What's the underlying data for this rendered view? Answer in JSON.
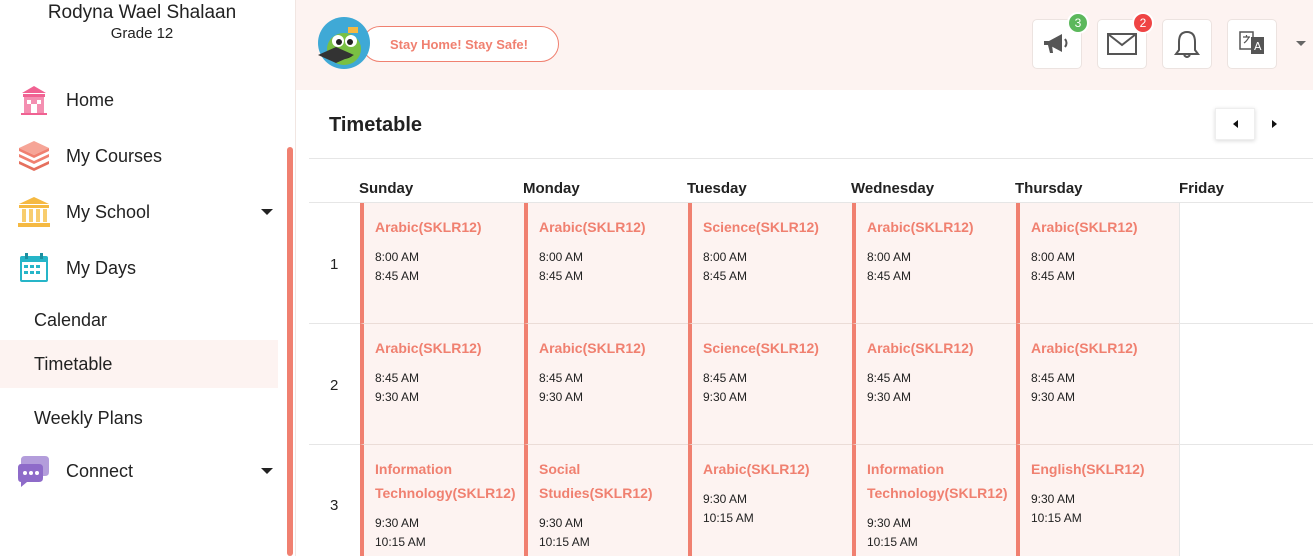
{
  "profile": {
    "name": "Rodyna Wael Shalaan",
    "grade": "Grade 12"
  },
  "sidebar": {
    "items": [
      {
        "label": "Home",
        "icon": "school-building-icon",
        "color": "#f06292"
      },
      {
        "label": "My Courses",
        "icon": "books-stack-icon",
        "color": "#f08070"
      },
      {
        "label": "My School",
        "icon": "institution-columns-icon",
        "color": "#f5b942"
      },
      {
        "label": "My Days",
        "icon": "calendar-icon",
        "color": "#26b5c8"
      }
    ],
    "sub_items": [
      {
        "label": "Calendar"
      },
      {
        "label": "Timetable",
        "active": true
      },
      {
        "label": "Weekly Plans"
      }
    ],
    "connect": {
      "label": "Connect",
      "icon": "chat-bubbles-icon",
      "color": "#8e6bc9"
    }
  },
  "topbar": {
    "banner": "Stay Home! Stay Safe!",
    "announcements_badge": "3",
    "messages_badge": "2"
  },
  "timetable": {
    "title": "Timetable",
    "days": [
      "Sunday",
      "Monday",
      "Tuesday",
      "Wednesday",
      "Thursday",
      "Friday"
    ],
    "periods": [
      {
        "number": "1",
        "cells": [
          {
            "subject": "Arabic(SKLR12)",
            "start": "8:00 AM",
            "end": "8:45 AM"
          },
          {
            "subject": "Arabic(SKLR12)",
            "start": "8:00 AM",
            "end": "8:45 AM"
          },
          {
            "subject": "Science(SKLR12)",
            "start": "8:00 AM",
            "end": "8:45 AM"
          },
          {
            "subject": "Arabic(SKLR12)",
            "start": "8:00 AM",
            "end": "8:45 AM"
          },
          {
            "subject": "Arabic(SKLR12)",
            "start": "8:00 AM",
            "end": "8:45 AM"
          }
        ]
      },
      {
        "number": "2",
        "cells": [
          {
            "subject": "Arabic(SKLR12)",
            "start": "8:45 AM",
            "end": "9:30 AM"
          },
          {
            "subject": "Arabic(SKLR12)",
            "start": "8:45 AM",
            "end": "9:30 AM"
          },
          {
            "subject": "Science(SKLR12)",
            "start": "8:45 AM",
            "end": "9:30 AM"
          },
          {
            "subject": "Arabic(SKLR12)",
            "start": "8:45 AM",
            "end": "9:30 AM"
          },
          {
            "subject": "Arabic(SKLR12)",
            "start": "8:45 AM",
            "end": "9:30 AM"
          }
        ]
      },
      {
        "number": "3",
        "cells": [
          {
            "subject": "Information Technology(SKLR12)",
            "start": "9:30 AM",
            "end": "10:15 AM"
          },
          {
            "subject": "Social Studies(SKLR12)",
            "start": "9:30 AM",
            "end": "10:15 AM"
          },
          {
            "subject": "Arabic(SKLR12)",
            "start": "9:30 AM",
            "end": "10:15 AM"
          },
          {
            "subject": "Information Technology(SKLR12)",
            "start": "9:30 AM",
            "end": "10:15 AM"
          },
          {
            "subject": "English(SKLR12)",
            "start": "9:30 AM",
            "end": "10:15 AM"
          }
        ]
      }
    ]
  },
  "colors": {
    "accent": "#f08070",
    "cell_bg": "#fdf3f1",
    "topbar_bg": "#fdf3f1"
  }
}
